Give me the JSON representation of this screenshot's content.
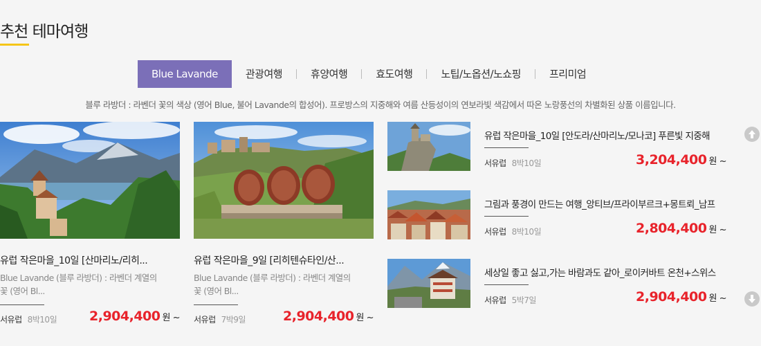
{
  "section": {
    "title": "추천 테마여행"
  },
  "tabs": [
    {
      "label": "Blue Lavande",
      "active": true
    },
    {
      "label": "관광여행"
    },
    {
      "label": "휴양여행"
    },
    {
      "label": "효도여행"
    },
    {
      "label": "노팁/노옵션/노쇼핑"
    },
    {
      "label": "프리미엄"
    }
  ],
  "description": "블루 라방더 : 라벤더 꽃의 색상 (영어 Blue, 불어 Lavande의 합성어). 프로방스의 지중해와 여름 산등성이의 연보라빛 색감에서 따온 노랑풍선의 차별화된 상품 이름입니다.",
  "cards": [
    {
      "title": "유럽 작은마을_10일 [산마리노/리히...",
      "subtitle": "Blue Lavande (블루 라방더) : 라벤더 계열의 꽃 (영어 Bl...",
      "region": "서유럽",
      "duration": "8박10일",
      "price": "2,904,400",
      "won": "원 ~"
    },
    {
      "title": "유럽 작은마을_9일 [리히텐슈타인/산...",
      "subtitle": "Blue Lavande (블루 라방더) : 라벤더 계열의 꽃 (영어 Bl...",
      "region": "서유럽",
      "duration": "7박9일",
      "price": "2,904,400",
      "won": "원 ~"
    }
  ],
  "list": [
    {
      "title": "유럽 작은마을_10일 [안도라/산마리노/모나코] 푸른빛 지중해",
      "region": "서유럽",
      "duration": "8박10일",
      "price": "3,204,400",
      "won": "원 ~"
    },
    {
      "title": "그림과 풍경이 만드는 여행_앙티브/프라이부르크+몽트뢰_남프",
      "region": "서유럽",
      "duration": "8박10일",
      "price": "2,804,400",
      "won": "원 ~"
    },
    {
      "title": "세상일 좋고 싫고,가는 바람과도 같아_로이커바트 온천+스위스",
      "region": "서유럽",
      "duration": "5박7일",
      "price": "2,904,400",
      "won": "원 ~"
    }
  ],
  "icons": {
    "scroll_up": "arrow-up-circle-icon",
    "scroll_down": "arrow-down-circle-icon"
  },
  "colors": {
    "accent": "#7b6fb8",
    "price": "#e8232b",
    "underline": "#f5c518"
  }
}
